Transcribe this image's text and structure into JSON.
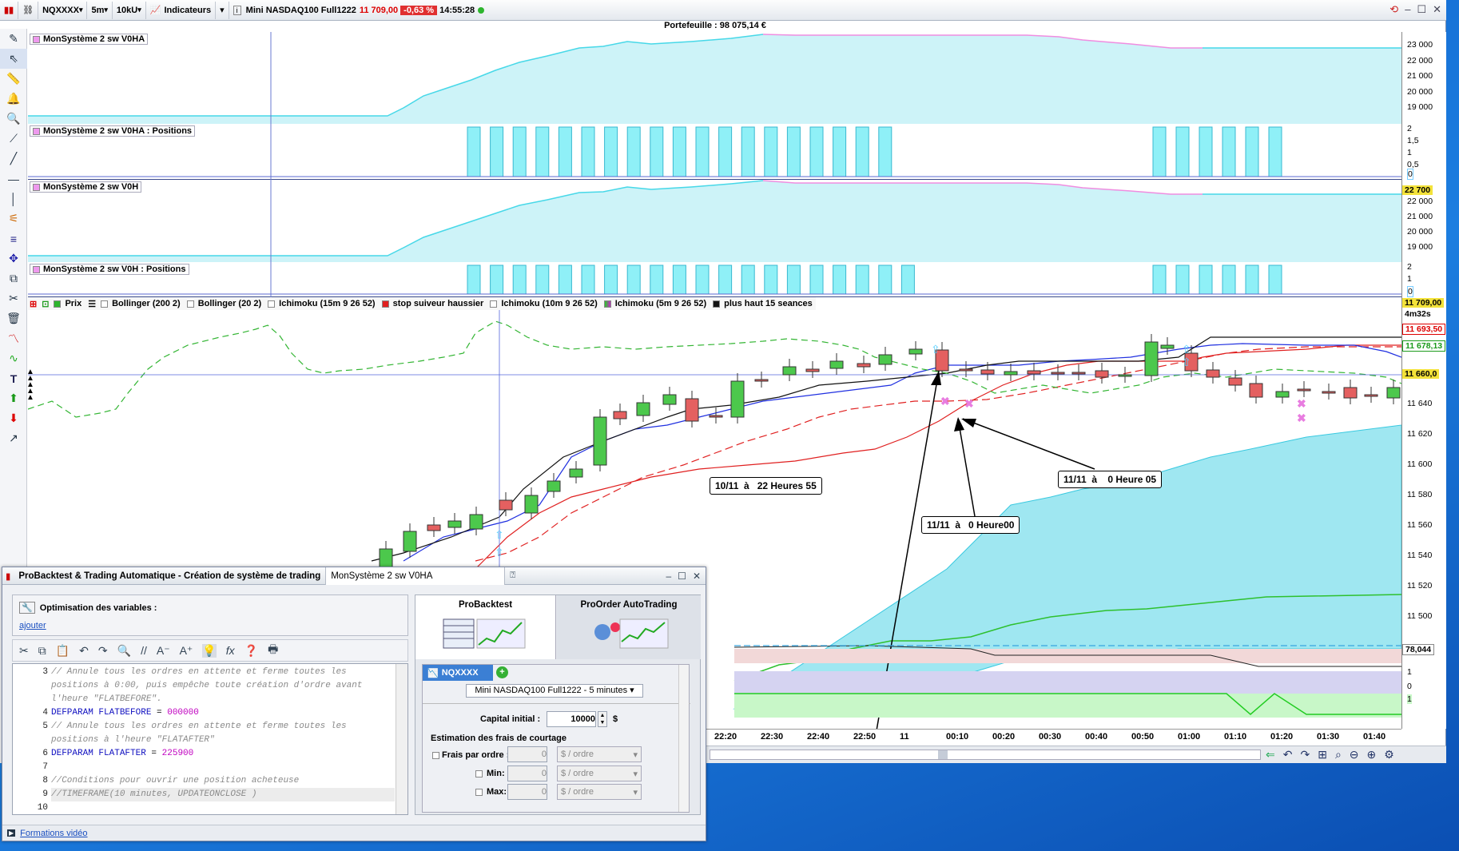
{
  "toolbar": {
    "ticker": "NQXXXX",
    "timeframe": "5m",
    "units": "10kU",
    "indicators_label": "Indicateurs",
    "instrument": "Mini NASDAQ100 Full1222",
    "price": "11 709,00",
    "change": "-0,63 %",
    "time": "14:55:28"
  },
  "portfolio": "Portefeuille : 98 075,14 €",
  "panes": [
    {
      "label": "MonSystème 2 sw V0HA",
      "ticks": [
        "23 000",
        "22 000",
        "21 000",
        "20 000",
        "19 000"
      ]
    },
    {
      "label": "MonSystème 2 sw V0HA : Positions",
      "ticks": [
        "2",
        "1,5",
        "1",
        "0,5",
        "0"
      ]
    },
    {
      "label": "MonSystème 2 sw V0H",
      "ticks": [
        "22 700",
        "22 000",
        "21 000",
        "20 000",
        "19 000"
      ]
    },
    {
      "label": "MonSystème 2 sw V0H : Positions",
      "ticks": [
        "2",
        "1",
        "0"
      ]
    }
  ],
  "legend": [
    "Prix",
    "Bollinger (200 2)",
    "Bollinger (20 2)",
    "Ichimoku (15m 9 26 52)",
    "stop suiveur haussier",
    "Ichimoku (10m 9 26 52)",
    "Ichimoku (5m 9 26 52)",
    "plus haut 15 seances"
  ],
  "price_axis": {
    "ticks": [
      "11 640",
      "11 620",
      "11 600",
      "11 580",
      "11 560",
      "11 540",
      "11 520",
      "11 500"
    ],
    "tag_last": "11 709,00",
    "tag_countdown": "4m32s",
    "tag_red": "11 693,50",
    "tag_green": "11 678,13",
    "tag_yellow": "11 660,0",
    "ind_value": "78,044",
    "ind_ticks": [
      "1",
      "0",
      "1"
    ]
  },
  "annotations": [
    "10/11  à   22 Heures 55",
    "11/11  à   0 Heure00",
    "11/11  à    0 Heure 05"
  ],
  "time_axis": [
    "22:20",
    "22:30",
    "22:40",
    "22:50",
    "11",
    "00:10",
    "00:20",
    "00:30",
    "00:40",
    "00:50",
    "01:00",
    "01:10",
    "01:20",
    "01:30",
    "01:40"
  ],
  "dialog": {
    "title": "ProBacktest & Trading Automatique - Création de système de trading",
    "tab": "MonSystème 2 sw V0HA",
    "opt_title": "Optimisation des variables :",
    "add_link": "ajouter",
    "code": [
      {
        "n": "3",
        "t": "// Annule tous les ordres en attente et ferme toutes les",
        "c": "cm"
      },
      {
        "n": "",
        "t": "positions à 0:00, puis empêche toute création d'ordre avant",
        "c": "cm"
      },
      {
        "n": "",
        "t": "l'heure \"FLATBEFORE\".",
        "c": "cm"
      },
      {
        "n": "4",
        "k": "DEFPARAM FLATBEFORE",
        "v": "000000"
      },
      {
        "n": "5",
        "t": "// Annule tous les ordres en attente et ferme toutes les",
        "c": "cm"
      },
      {
        "n": "",
        "t": "positions à l'heure \"FLATAFTER\"",
        "c": "cm"
      },
      {
        "n": "6",
        "k": "DEFPARAM FLATAFTER",
        "v": "225900"
      },
      {
        "n": "7",
        "t": "",
        "c": ""
      },
      {
        "n": "8",
        "t": "//Conditions pour ouvrir une position acheteuse",
        "c": "cm"
      },
      {
        "n": "9",
        "t": "//TIMEFRAME(10 minutes, UPDATEONCLOSE )",
        "c": "cm"
      },
      {
        "n": "10",
        "t": "",
        "c": ""
      }
    ],
    "tab_backtest": "ProBacktest",
    "tab_autotrading": "ProOrder AutoTrading",
    "ticker_tab": "NQXXXX",
    "instrument_select": "Mini NASDAQ100 Full1222 - 5 minutes",
    "capital_label": "Capital initial :",
    "capital_value": "10000",
    "currency": "$",
    "fees_title": "Estimation des frais de courtage",
    "fees_per_order": "Frais par ordre :",
    "min_label": "Min:",
    "max_label": "Max:",
    "zero": "0",
    "unit_option": "$ / ordre",
    "footer_link": "Formations vidéo"
  }
}
